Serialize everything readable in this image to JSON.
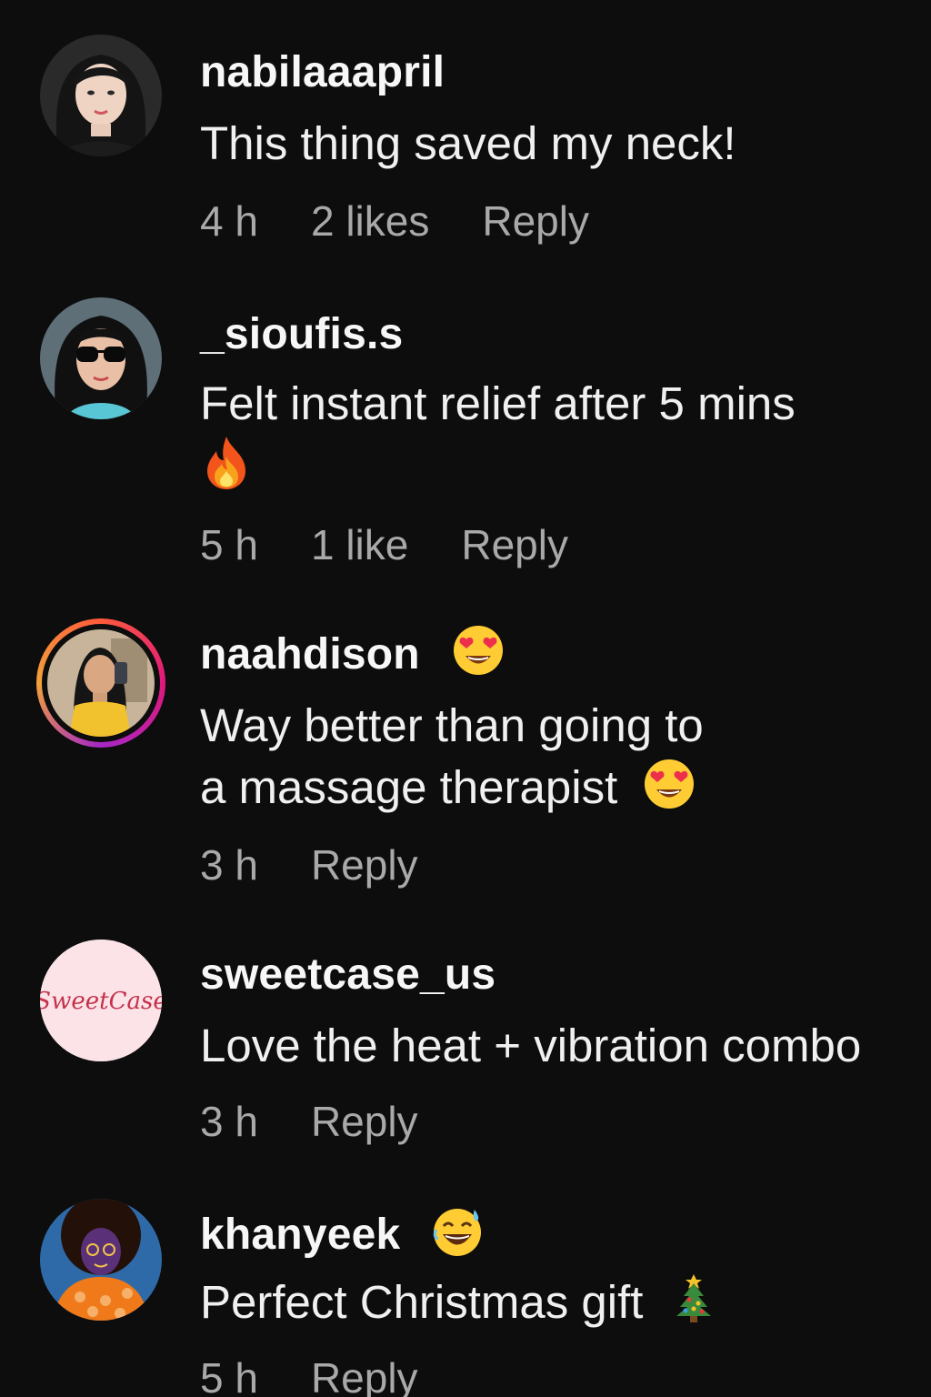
{
  "comments": [
    {
      "username": "nabilaaapril",
      "text": "This thing saved my neck!",
      "time": "4 h",
      "likes": "2 likes",
      "reply": "Reply",
      "avatar_icon": "woman-portrait-avatar"
    },
    {
      "username": "_sioufis.s",
      "text_line1": "Felt instant relief after 5 mins",
      "text_emoji": "fire-emoji",
      "time": "5 h",
      "likes": "1 like",
      "reply": "Reply",
      "avatar_icon": "woman-sunglasses-avatar"
    },
    {
      "username": "naahdison",
      "username_emoji": "heart-eyes-emoji",
      "text_line1": "Way better than going to",
      "text_line2": "a massage therapist",
      "text_emoji": "heart-eyes-emoji",
      "time": "3 h",
      "reply": "Reply",
      "avatar_icon": "story-ring-avatar",
      "story_ring": true
    },
    {
      "username": "sweetcase_us",
      "text": "Love the heat + vibration combo",
      "time": "3 h",
      "reply": "Reply",
      "avatar_icon": "brand-logo-avatar",
      "avatar_logo_text": "SweetCase"
    },
    {
      "username": "khanyeek",
      "username_emoji": "grinning-sweat-emoji",
      "text": "Perfect Christmas gift",
      "text_emoji": "christmas-tree-emoji",
      "time": "5 h",
      "reply": "Reply",
      "avatar_icon": "illustrated-avatar"
    }
  ],
  "colors": {
    "background": "#0d0d0d",
    "username": "#f7f7f7",
    "text": "#f0f0f0",
    "meta": "#a9a9a9",
    "story_ring": [
      "#ff5a3c",
      "#e0187c",
      "#a527c5",
      "#f2a23a"
    ],
    "brand_avatar_bg": "#fbe3e8",
    "brand_logo": "#c4324a"
  }
}
